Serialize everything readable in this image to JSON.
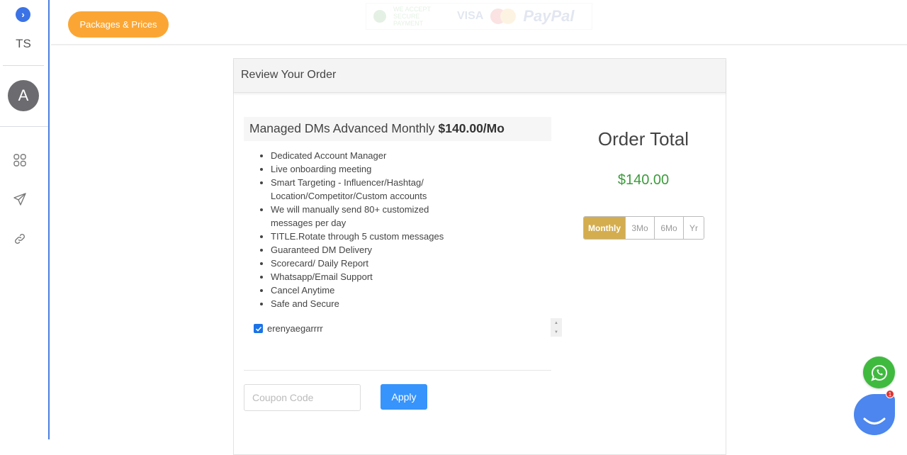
{
  "sidebar": {
    "expand_icon": "chevron-right-icon",
    "workspace_initials": "TS",
    "avatar_initial": "A",
    "nav_icons": [
      "grid-icon",
      "send-icon",
      "link-icon"
    ]
  },
  "topbar": {
    "packages_button": "Packages & Prices",
    "payment_logos": {
      "secure": "WE ACCEPT SECURE PAYMENT",
      "visa": "VISA",
      "paypal": "PayPal"
    }
  },
  "order": {
    "header": "Review Your Order",
    "product_name": "Managed DMs Advanced Monthly ",
    "product_price": "$140.00/Mo",
    "features": [
      "Dedicated Account Manager",
      "Live onboarding meeting",
      "Smart Targeting - Influencer/Hashtag/ Location/Competitor/Custom accounts",
      "We will manually send 80+ customized messages per day",
      "TITLE.Rotate through 5 custom messages",
      "Guaranteed DM Delivery",
      "Scorecard/ Daily Report",
      "Whatsapp/Email Support",
      "Cancel Anytime",
      "Safe and Secure"
    ],
    "account": {
      "checked": true,
      "username": "erenyaegarrrr"
    },
    "coupon": {
      "placeholder": "Coupon Code",
      "value": "",
      "apply_label": "Apply"
    },
    "total_label": "Order Total",
    "total_amount": "$140.00",
    "periods": [
      {
        "label": "Monthly",
        "active": true
      },
      {
        "label": "3Mo",
        "active": false
      },
      {
        "label": "6Mo",
        "active": false
      },
      {
        "label": "Yr",
        "active": false
      }
    ]
  },
  "widgets": {
    "whatsapp_icon": "whatsapp-icon",
    "chat_icon": "chat-smile-icon",
    "chat_badge_count": "1"
  },
  "colors": {
    "accent_blue": "#3794fc",
    "packages_orange": "#fba634",
    "period_active_gold": "#d4ad4e",
    "total_green": "#3c9b3c",
    "whatsapp_green": "#3fba3f",
    "chat_blue": "#4c86ee"
  }
}
